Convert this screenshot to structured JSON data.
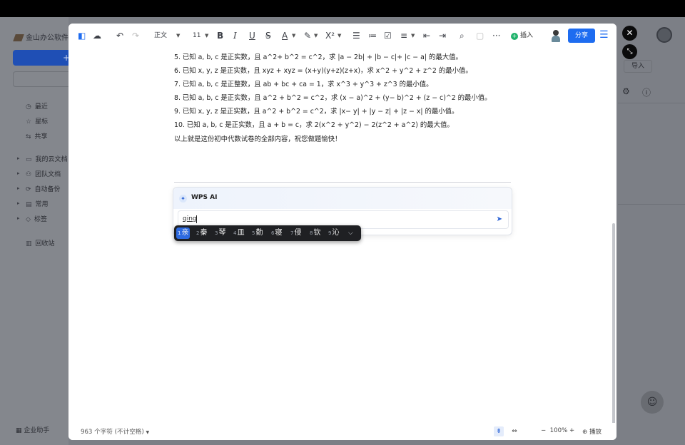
{
  "background_app": {
    "app_name": "金山办公软件",
    "new_button_label": "+",
    "import_label": "导入",
    "sidebar_items": [
      {
        "label": "最近",
        "icon": "clock-icon"
      },
      {
        "label": "星标",
        "icon": "star-icon"
      },
      {
        "label": "共享",
        "icon": "share-icon"
      },
      {
        "label": "我的云文档",
        "icon": "folder-icon"
      },
      {
        "label": "团队文档",
        "icon": "team-icon"
      },
      {
        "label": "自动备份",
        "icon": "backup-icon"
      },
      {
        "label": "常用",
        "icon": "pin-icon"
      },
      {
        "label": "标签",
        "icon": "tag-icon"
      },
      {
        "label": "回收站",
        "icon": "trash-icon"
      }
    ],
    "footer_label": "企业助手"
  },
  "toolbar": {
    "style_label": "正文",
    "font_size": "11",
    "insert_label": "插入",
    "share_label": "分享"
  },
  "document": {
    "lines": [
      "5.  已知 a, b, c 是正实数，且 a^2+ b^2 = c^2，求 |a − 2b| + |b − c|+ |c − a| 的最大值。",
      "6.  已知 x, y, z 是正实数，且 xyz + xyz = (x+y)(y+z)(z+x)，求 x^2 + y^2 + z^2 的最小值。",
      "7.  已知 a, b, c 是正整数，且 ab + bc + ca = 1，求 x^3 + y^3 + z^3 的最小值。",
      "8.  已知 a, b, c 是正实数，且 a^2 + b^2 = c^2，求 (x − a)^2 + (y− b)^2 + (z − c)^2 的最小值。",
      "9.  已知 x, y, z 是正实数，且 a^2 + b^2 = c^2，求 |x− y| + |y − z| + |z − x| 的最小值。",
      "10.  已知 a, b, c 是正实数，且 a + b = c，求 2(x^2 + y^2) − 2(z^2 + a^2) 的最大值。",
      "以上就是这份初中代数试卷的全部内容，祝您做题愉快！"
    ]
  },
  "ai_panel": {
    "title": "WPS AI",
    "input_value": "qing"
  },
  "ime": {
    "candidates": [
      {
        "num": "1",
        "text": "亲"
      },
      {
        "num": "2",
        "text": "秦"
      },
      {
        "num": "3",
        "text": "琴"
      },
      {
        "num": "4",
        "text": "皿"
      },
      {
        "num": "5",
        "text": "勤"
      },
      {
        "num": "6",
        "text": "寝"
      },
      {
        "num": "7",
        "text": "侵"
      },
      {
        "num": "8",
        "text": "钦"
      },
      {
        "num": "9",
        "text": "沁"
      }
    ],
    "selected_index": 0
  },
  "status_bar": {
    "word_count": "963 个字符 (不计空格)",
    "zoom": "100%",
    "play_label": "播放"
  }
}
